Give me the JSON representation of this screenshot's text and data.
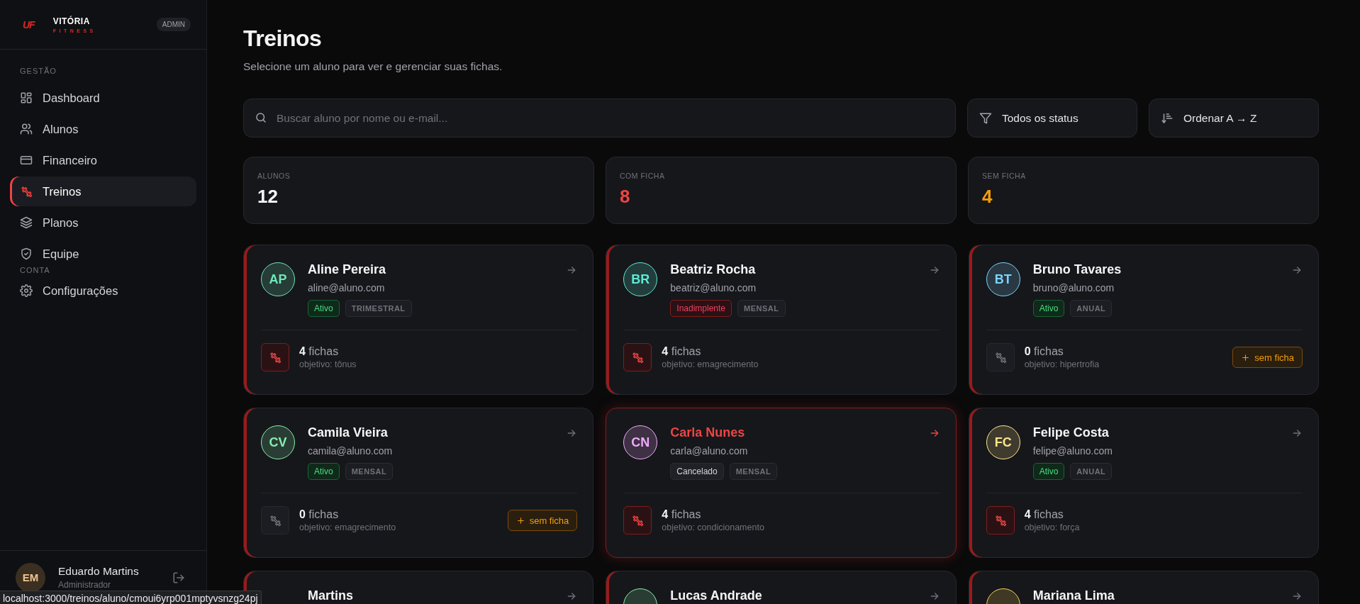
{
  "sidebar": {
    "logo": {
      "mark": "UF",
      "name": "VITÓRIA",
      "tagline": "FITNESS"
    },
    "role_badge": "ADMIN",
    "sections": [
      {
        "title": "GESTÃO",
        "items": [
          {
            "label": "Dashboard",
            "selected": false
          },
          {
            "label": "Alunos",
            "selected": false
          },
          {
            "label": "Financeiro",
            "selected": false
          },
          {
            "label": "Treinos",
            "selected": true
          },
          {
            "label": "Planos",
            "selected": false
          },
          {
            "label": "Equipe",
            "selected": false
          }
        ]
      },
      {
        "title": "CONTA",
        "items": [
          {
            "label": "Configurações",
            "selected": false
          }
        ]
      }
    ],
    "user": {
      "initials": "EM",
      "name": "Eduardo Martins",
      "role": "Administrador"
    }
  },
  "page": {
    "title": "Treinos",
    "subtitle": "Selecione um aluno para ver e gerenciar suas fichas."
  },
  "toolbar": {
    "search": {
      "placeholder": "Buscar aluno por nome ou e-mail..."
    },
    "filter": "Todos os status",
    "sort": "Ordenar A → Z"
  },
  "stats": [
    {
      "label": "ALUNOS",
      "value": "12",
      "color": "#f4f4f5"
    },
    {
      "label": "COM FICHA",
      "value": "8",
      "color": "#ef4444"
    },
    {
      "label": "SEM FICHA",
      "value": "4",
      "color": "#f59e0b"
    }
  ],
  "students": [
    {
      "initials": "AP",
      "color": "#6ee7b7",
      "name": "Aline Pereira",
      "email": "aline@aluno.com",
      "status": {
        "label": "Ativo",
        "kind": "active"
      },
      "plan": "TRIMESTRAL",
      "fichas": "**4** fichas",
      "has_fichas": true,
      "goal": "objetivo: tônus",
      "selected": false
    },
    {
      "initials": "BR",
      "color": "#5eead4",
      "name": "Beatriz Rocha",
      "email": "beatriz@aluno.com",
      "status": {
        "label": "Inadimplente",
        "kind": "overdue"
      },
      "plan": "MENSAL",
      "fichas": "**4** fichas",
      "has_fichas": true,
      "goal": "objetivo: emagrecimento",
      "selected": false
    },
    {
      "initials": "BT",
      "color": "#7dd3fc",
      "name": "Bruno Tavares",
      "email": "bruno@aluno.com",
      "status": {
        "label": "Ativo",
        "kind": "active"
      },
      "plan": "ANUAL",
      "fichas": "**0** fichas",
      "has_fichas": false,
      "goal": "objetivo: hipertrofia",
      "badge": "sem ficha",
      "selected": false
    },
    {
      "initials": "CV",
      "color": "#86efac",
      "name": "Camila Vieira",
      "email": "camila@aluno.com",
      "status": {
        "label": "Ativo",
        "kind": "active"
      },
      "plan": "MENSAL",
      "fichas": "**0** fichas",
      "has_fichas": false,
      "goal": "objetivo: emagrecimento",
      "badge": "sem ficha",
      "selected": false
    },
    {
      "initials": "CN",
      "color": "#f0abfc",
      "name": "Carla Nunes",
      "email": "carla@aluno.com",
      "status": {
        "label": "Cancelado",
        "kind": "cancelled"
      },
      "plan": "MENSAL",
      "fichas": "**4** fichas",
      "has_fichas": true,
      "goal": "objetivo: condicionamento",
      "selected": true
    },
    {
      "initials": "FC",
      "color": "#fde68a",
      "name": "Felipe Costa",
      "email": "felipe@aluno.com",
      "status": {
        "label": "Ativo",
        "kind": "active"
      },
      "plan": "ANUAL",
      "fichas": "**4** fichas",
      "has_fichas": true,
      "goal": "objetivo: força",
      "selected": false
    },
    {
      "name": "Martins",
      "selected": false
    },
    {
      "color": "#86efac",
      "name": "Lucas Andrade",
      "selected": false
    },
    {
      "color": "#fcd34d",
      "name": "Mariana Lima",
      "selected": false
    }
  ],
  "link_preview": "localhost:3000/treinos/aluno/cmoui6yrp001mptyvsnzg24pj"
}
